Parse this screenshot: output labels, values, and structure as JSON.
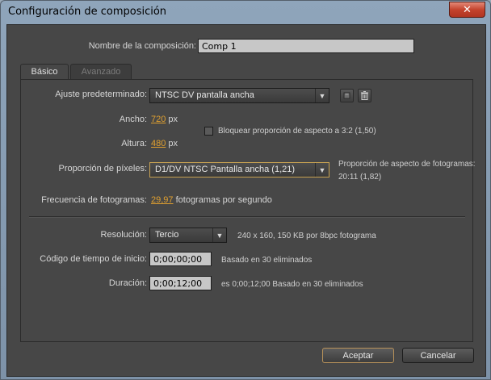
{
  "window": {
    "title": "Configuración de composición",
    "close_glyph": "✕"
  },
  "comp_name": {
    "label": "Nombre de la composición:",
    "value": "Comp 1"
  },
  "tabs": [
    {
      "label": "Básico",
      "active": true
    },
    {
      "label": "Avanzado",
      "active": false
    }
  ],
  "preset": {
    "label": "Ajuste predeterminado:",
    "value": "NTSC DV pantalla ancha",
    "save_icon": "save-preset-icon",
    "delete_icon": "trash-icon"
  },
  "width": {
    "label": "Ancho:",
    "value": "720",
    "unit": "px"
  },
  "height": {
    "label": "Altura:",
    "value": "480",
    "unit": "px"
  },
  "lock_aspect": {
    "label": "Bloquear proporción de aspecto a 3:2 (1,50)",
    "checked": false
  },
  "pixel_aspect": {
    "label": "Proporción de píxeles:",
    "value": "D1/DV NTSC Pantalla ancha (1,21)"
  },
  "frame_aspect": {
    "label": "Proporción de aspecto de fotogramas:",
    "value": "20:11 (1,82)"
  },
  "frame_rate": {
    "label": "Frecuencia de fotogramas:",
    "value": "29,97",
    "unit": "fotogramas por segundo"
  },
  "resolution": {
    "label": "Resolución:",
    "value": "Tercio",
    "info": "240 x 160, 150 KB por 8bpc fotograma"
  },
  "start_timecode": {
    "label": "Código de tiempo de inicio:",
    "value": "0;00;00;00",
    "info": "Basado en 30 eliminados"
  },
  "duration": {
    "label": "Duración:",
    "value": "0;00;12;00",
    "info": "es 0;00;12;00  Basado en 30 eliminados"
  },
  "buttons": {
    "ok": "Aceptar",
    "cancel": "Cancelar"
  },
  "colors": {
    "accent_link": "#e0a030",
    "dialog_bg": "#474747",
    "highlight_border": "#c9a352"
  }
}
